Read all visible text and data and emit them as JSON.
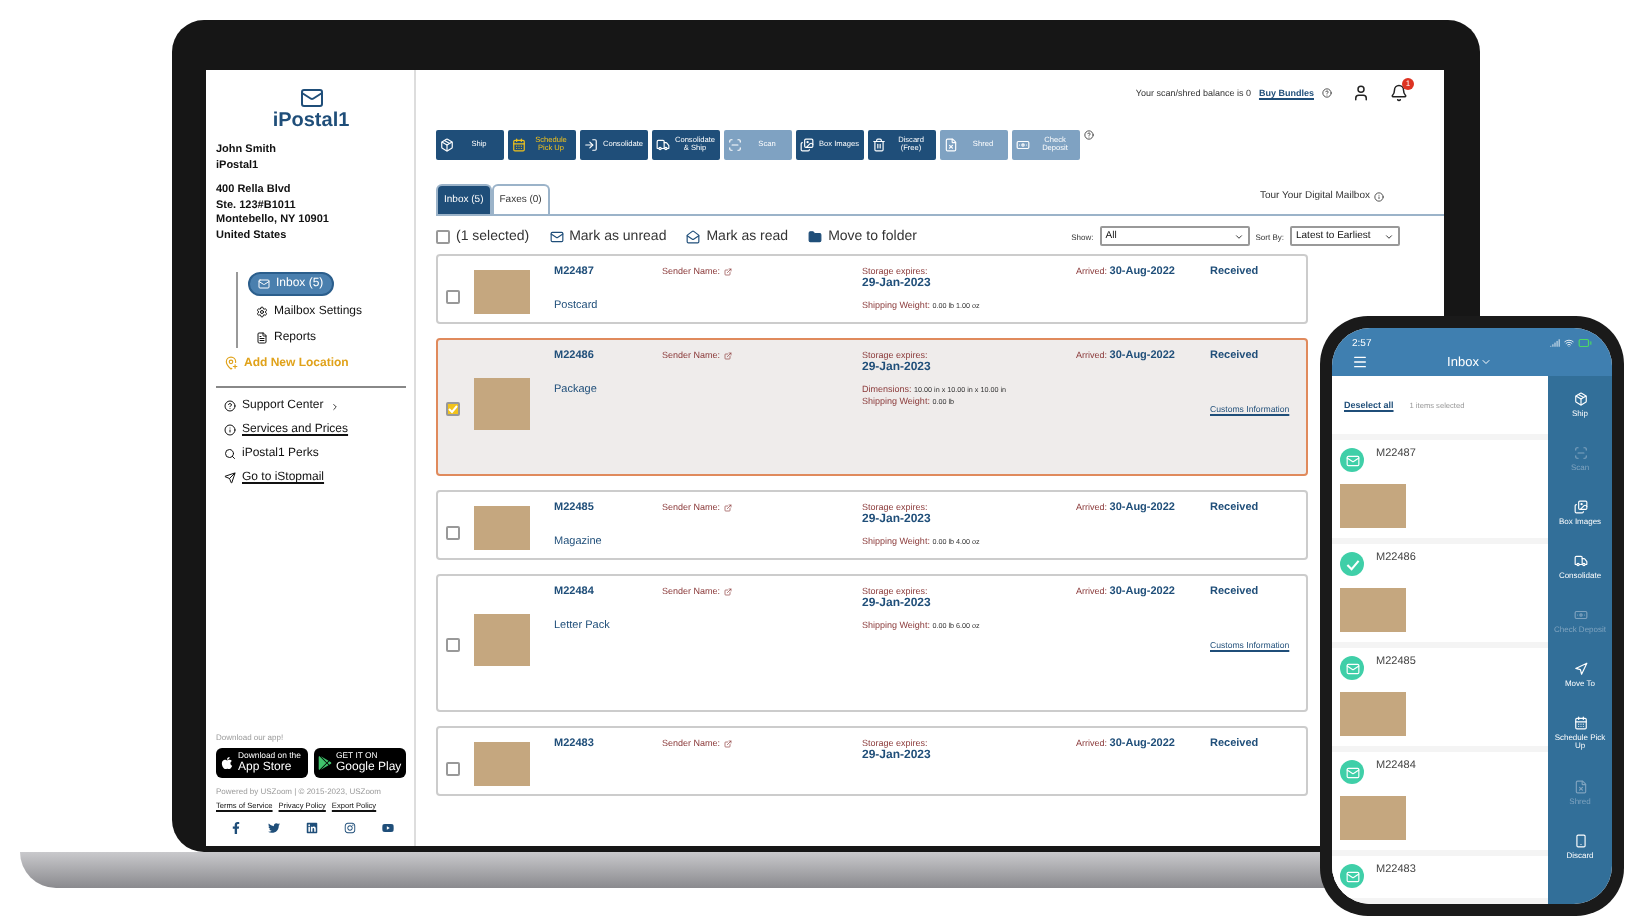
{
  "sidebar": {
    "logo": "iPostal1",
    "account": [
      "John Smith",
      "iPostal1"
    ],
    "address": [
      "400 Rella Blvd",
      "Ste. 123#B1011",
      "Montebello, NY 10901",
      "United States"
    ],
    "nav": [
      {
        "label": "Inbox (5)",
        "selected": true
      },
      {
        "label": "Mailbox Settings",
        "selected": false
      },
      {
        "label": "Reports",
        "selected": false
      }
    ],
    "add_location": "Add New Location",
    "links": [
      {
        "label": "Support Center",
        "kind": "menu"
      },
      {
        "label": "Services and Prices",
        "kind": "link"
      },
      {
        "label": "iPostal1 Perks",
        "kind": "plain"
      },
      {
        "label": "Go to iStopmail",
        "kind": "link"
      }
    ],
    "app_prompt": "Download our app!",
    "app_badges": [
      {
        "small": "Download on the",
        "big": "App Store"
      },
      {
        "small": "GET IT ON",
        "big": "Google Play"
      }
    ],
    "copyright": "Powered by USZoom | © 2015-2023, USZoom",
    "footer_links": [
      "Terms of Service",
      "Privacy Policy",
      "Export Policy"
    ]
  },
  "header": {
    "balance": "Your scan/shred balance is 0",
    "buy_link": "Buy Bundles",
    "notifications": "1"
  },
  "toolbar": [
    {
      "label": "Ship",
      "disabled": false,
      "accent": false
    },
    {
      "label": "Schedule Pick Up",
      "disabled": false,
      "accent": true
    },
    {
      "label": "Consolidate",
      "disabled": false,
      "accent": false
    },
    {
      "label": "Consolidate & Ship",
      "disabled": false,
      "accent": false
    },
    {
      "label": "Scan",
      "disabled": true,
      "accent": false
    },
    {
      "label": "Box Images",
      "disabled": false,
      "accent": false
    },
    {
      "label": "Discard (Free)",
      "disabled": false,
      "accent": false
    },
    {
      "label": "Shred",
      "disabled": true,
      "accent": false
    },
    {
      "label": "Check Deposit",
      "disabled": true,
      "accent": false
    }
  ],
  "tabs": [
    {
      "label": "Inbox (5)",
      "selected": true
    },
    {
      "label": "Faxes (0)",
      "selected": false
    }
  ],
  "tour_link": "Tour Your Digital Mailbox",
  "actions": {
    "selection": "(1 selected)",
    "checked": false,
    "buttons": [
      "Mark as unread",
      "Mark as read",
      "Move to folder"
    ],
    "show_label": "Show:",
    "show_value": "All",
    "sort_label": "Sort By:",
    "sort_value": "Latest to Earliest"
  },
  "rows": [
    {
      "id": "M22487",
      "type": "Postcard",
      "selected": false,
      "sender": "Sender Name:",
      "storage_label": "Storage expires:",
      "storage_date": "29-Jan-2023",
      "weight_label": "Shipping Weight:",
      "weight": "0.00 lb 1.00 oz",
      "arrived_label": "Arrived:",
      "arrived": "30-Aug-2022",
      "status": "Received"
    },
    {
      "id": "M22486",
      "type": "Package",
      "selected": true,
      "sender": "Sender Name:",
      "storage_label": "Storage expires:",
      "storage_date": "29-Jan-2023",
      "dimensions_label": "Dimensions:",
      "dimensions": "10.00 in x 10.00 in x 10.00 in",
      "weight_label": "Shipping Weight:",
      "weight": "0.00 lb",
      "arrived_label": "Arrived:",
      "arrived": "30-Aug-2022",
      "status": "Received",
      "customs": "Customs Information"
    },
    {
      "id": "M22485",
      "type": "Magazine",
      "selected": false,
      "sender": "Sender Name:",
      "storage_label": "Storage expires:",
      "storage_date": "29-Jan-2023",
      "weight_label": "Shipping Weight:",
      "weight": "0.00 lb 4.00 oz",
      "arrived_label": "Arrived:",
      "arrived": "30-Aug-2022",
      "status": "Received"
    },
    {
      "id": "M22484",
      "type": "Letter Pack",
      "selected": false,
      "sender": "Sender Name:",
      "storage_label": "Storage expires:",
      "storage_date": "29-Jan-2023",
      "weight_label": "Shipping Weight:",
      "weight": "0.00 lb 6.00 oz",
      "arrived_label": "Arrived:",
      "arrived": "30-Aug-2022",
      "status": "Received",
      "customs": "Customs Information"
    },
    {
      "id": "M22483",
      "selected": false,
      "sender": "Sender Name:",
      "storage_label": "Storage expires:",
      "storage_date": "29-Jan-2023",
      "arrived_label": "Arrived:",
      "arrived": "30-Aug-2022",
      "status": "Received"
    }
  ],
  "phone": {
    "time": "2:57",
    "title": "Inbox",
    "deselect": "Deselect all",
    "count": "1 items selected",
    "items": [
      {
        "id": "M22487",
        "selected": false
      },
      {
        "id": "M22486",
        "selected": true
      },
      {
        "id": "M22485",
        "selected": false
      },
      {
        "id": "M22484",
        "selected": false
      },
      {
        "id": "M22483",
        "selected": false
      }
    ],
    "actions": [
      {
        "label": "Ship",
        "disabled": false
      },
      {
        "label": "Scan",
        "disabled": true
      },
      {
        "label": "Box Images",
        "disabled": false
      },
      {
        "label": "Consolidate",
        "disabled": false
      },
      {
        "label": "Check Deposit",
        "disabled": true
      },
      {
        "label": "Move To",
        "disabled": false
      },
      {
        "label": "Schedule Pick Up",
        "disabled": false
      },
      {
        "label": "Shred",
        "disabled": true
      },
      {
        "label": "Discard",
        "disabled": false
      }
    ]
  }
}
